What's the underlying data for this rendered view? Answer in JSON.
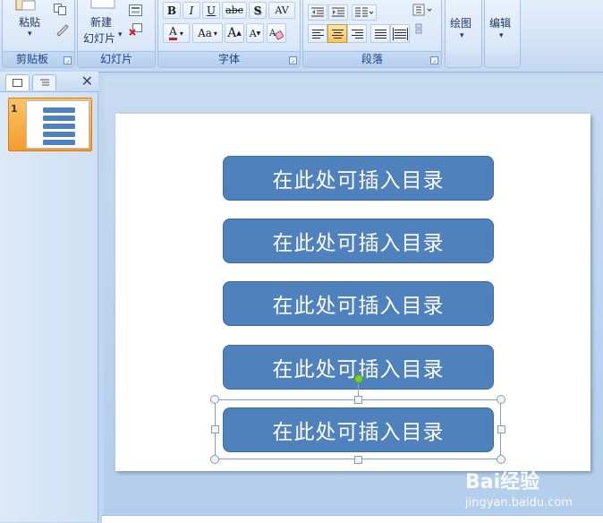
{
  "ribbon": {
    "clipboard": {
      "label": "剪贴板",
      "paste_label": "粘贴",
      "paste_arrow": "▾"
    },
    "slides": {
      "label": "幻灯片",
      "new_line1": "新建",
      "new_line2": "幻灯片",
      "new_arrow": "▾"
    },
    "font": {
      "label": "字体",
      "bold": "B",
      "italic": "I",
      "underline": "U",
      "strike": "abc",
      "shadow": "S",
      "spacing": "AV",
      "font_color": "A",
      "change_case": "Aa",
      "grow": "A",
      "shrink": "A"
    },
    "paragraph": {
      "label": "段落"
    },
    "drawing": {
      "label": "绘图",
      "arrow": "▾"
    },
    "editing": {
      "label": "编辑",
      "arrow": "▾"
    }
  },
  "left_pane": {
    "slide_number": "1",
    "close_glyph": "✕"
  },
  "slide": {
    "items": [
      "在此处可插入目录",
      "在此处可插入目录",
      "在此处可插入目录",
      "在此处可插入目录",
      "在此处可插入目录"
    ]
  },
  "watermark": {
    "line1": "Bai经验",
    "line2": "jingyan.baidu.com"
  },
  "colors": {
    "shape_fill": "#4f81bd",
    "ribbon_text": "#15428b",
    "thumb_highlight": "#f59b2d"
  }
}
